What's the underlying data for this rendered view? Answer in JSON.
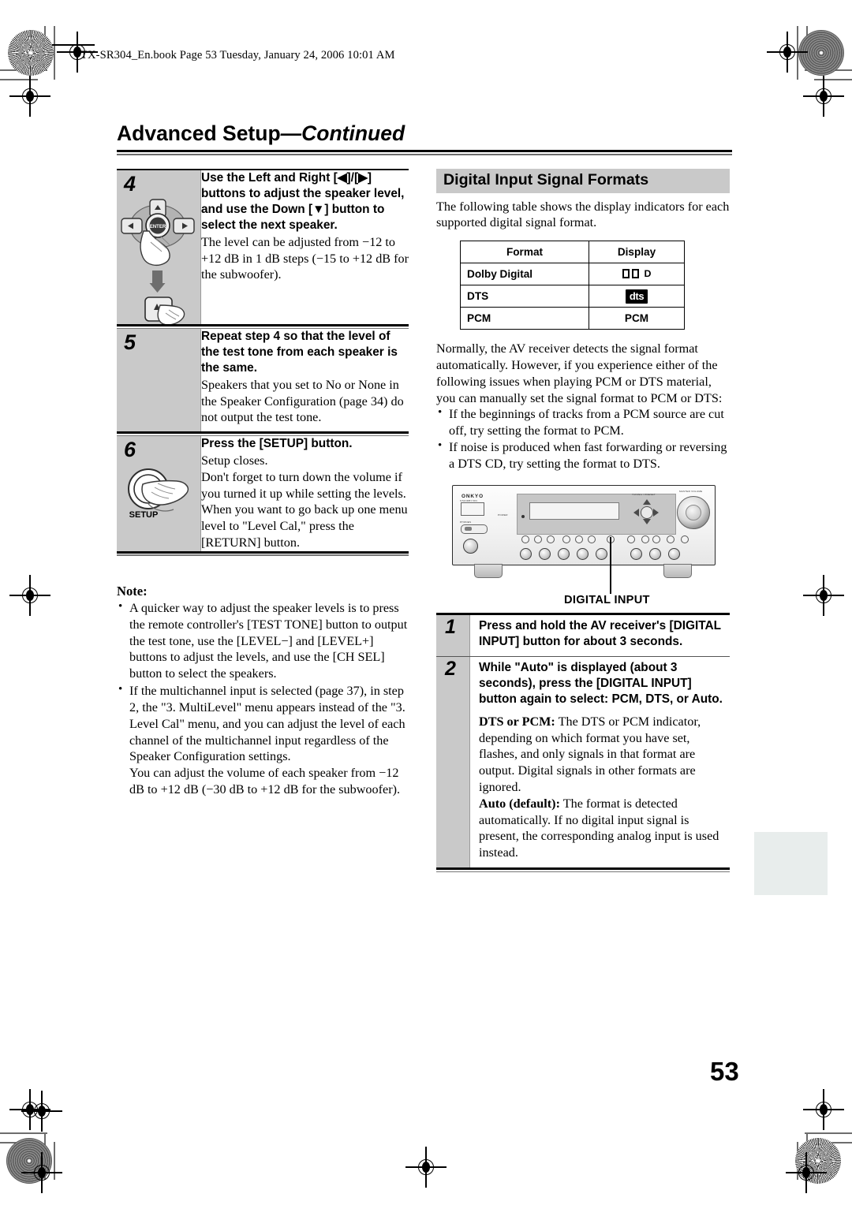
{
  "header": {
    "file_line": "TX-SR304_En.book  Page 53  Tuesday, January 24, 2006  10:01 AM"
  },
  "chapter": {
    "title_main": "Advanced Setup",
    "title_dash": "—",
    "title_cont": "Continued"
  },
  "left_column": {
    "steps": [
      {
        "number": "4",
        "bold": "Use the Left and Right [◀]/[▶] buttons to adjust the speaker level, and use the Down [▼] button to select the next speaker.",
        "body": "The level can be adjusted from −12 to +12 dB in 1 dB steps (−15 to +12 dB for the subwoofer).",
        "icon": "dpad-enter-button-illustration"
      },
      {
        "number": "5",
        "bold": "Repeat step 4 so that the level of the test tone from each speaker is the same.",
        "body": "Speakers that you set to No or None in the Speaker Configuration (page 34) do not output the test tone.",
        "icon": ""
      },
      {
        "number": "6",
        "bold": "Press the [SETUP] button.",
        "body": "Setup closes.\nDon't forget to turn down the volume if you turned it up while setting the levels.\nWhen you want to go back up one menu level to \"Level Cal,\" press the [RETURN] button.",
        "icon": "setup-button-illustration",
        "icon_label": "SETUP"
      }
    ],
    "note": {
      "heading": "Note:",
      "items": [
        "A quicker way to adjust the speaker levels is to press the remote controller's [TEST TONE] button to output the test tone, use the [LEVEL−] and [LEVEL+] buttons to adjust the levels, and use the [CH SEL] button to select the speakers.",
        "If the multichannel input is selected (page 37), in step 2, the \"3. MultiLevel\" menu appears instead of the \"3. Level Cal\" menu, and you can adjust the level of each channel of the multichannel input regardless of the Speaker Configuration settings.\nYou can adjust the volume of each speaker from −12 dB to +12 dB (−30 dB to +12 dB for the subwoofer)."
      ]
    }
  },
  "right_column": {
    "section_heading": "Digital Input Signal Formats",
    "intro": "The following table shows the display indicators for each supported digital signal format.",
    "table": {
      "headers": [
        "Format",
        "Display"
      ],
      "rows": [
        {
          "format": "Dolby Digital",
          "display": "D",
          "display_type": "dolby-glyph"
        },
        {
          "format": "DTS",
          "display": "dts",
          "display_type": "dts-logo"
        },
        {
          "format": "PCM",
          "display": "PCM",
          "display_type": "text"
        }
      ]
    },
    "body_para": "Normally, the AV receiver detects the signal format automatically. However, if you experience either of the following issues when playing PCM or DTS material, you can manually set the signal format to PCM or DTS:",
    "bullets": [
      "If the beginnings of tracks from a PCM source are cut off, try setting the format to PCM.",
      "If noise is produced when fast forwarding or reversing a DTS CD, try setting the format to DTS."
    ],
    "illustration": {
      "brand": "ONKYO",
      "callout_label": "DIGITAL INPUT"
    },
    "steps": [
      {
        "number": "1",
        "bold": "Press and hold the AV receiver's [DIGITAL INPUT] button for about 3 seconds.",
        "body": ""
      },
      {
        "number": "2",
        "bold": "While \"Auto\" is displayed (about 3 seconds), press the [DIGITAL INPUT] button again to select: PCM, DTS, or Auto.",
        "body": ""
      }
    ],
    "definitions": [
      {
        "term": "DTS or PCM:",
        "text": " The DTS or PCM indicator, depending on which format you have set, flashes, and only signals in that format are output. Digital signals in other formats are ignored."
      },
      {
        "term": "Auto (default):",
        "text": " The format is detected automatically. If no digital input signal is present, the corresponding analog input is used instead."
      }
    ]
  },
  "footer": {
    "page_number": "53"
  },
  "colors": {
    "step_number_bg": "#c9c9c9",
    "section_heading_bg": "#c9c9c9",
    "thumb_tab": "#e8edec",
    "rule": "#000000"
  }
}
